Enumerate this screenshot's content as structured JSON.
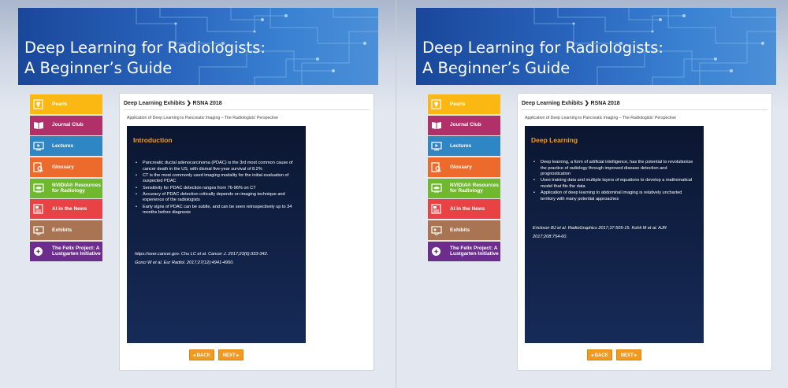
{
  "banner": {
    "title_line1": "Deep Learning for Radiologists:",
    "title_line2": "A Beginner’s Guide"
  },
  "sidebar": {
    "items": [
      {
        "label": "Pearls",
        "color": "#fbb813",
        "icon": "lightbulb-icon"
      },
      {
        "label": "Journal Club",
        "color": "#b2306a",
        "icon": "book-icon"
      },
      {
        "label": "Lectures",
        "color": "#2f86c4",
        "icon": "video-icon"
      },
      {
        "label": "Glossary",
        "color": "#ec6a2c",
        "icon": "glossary-icon"
      },
      {
        "label": "NVIDIA® Resources for Radiology",
        "color": "#70b92f",
        "icon": "nvidia-icon"
      },
      {
        "label": "AI in the News",
        "color": "#e84245",
        "icon": "news-icon"
      },
      {
        "label": "Exhibits",
        "color": "#a97451",
        "icon": "exhibit-icon"
      },
      {
        "label": "The Felix Project: A Lustgarten Initiative",
        "color": "#6c2d8c",
        "icon": "project-icon"
      }
    ]
  },
  "content": {
    "breadcrumb": "Deep Learning Exhibits ❯ RSNA 2018",
    "subtitle": "Application of Deep Learning to Pancreatic Imaging – The Radiologists’ Perspective",
    "back_label": "◂ BACK",
    "next_label": "NEXT ▸"
  },
  "slides": [
    {
      "title": "Introduction",
      "bullets": [
        "Pancreatic ductal adenocarcinoma (PDAC) is the 3rd most common cause of cancer death in the US, with dismal five-year survival of 8.2%",
        "CT is the most commonly used imaging modality for the initial evaluation of suspected PDAC",
        "Sensitivity for PDAC detection ranges from 76-96% on CT",
        "Accuracy of PDAC detection critically depends on imaging technique and experience of the radiologists",
        "Early signs of PDAC can be subtle, and can be seen retrospectively up to 34 months before diagnosis"
      ],
      "references": [
        "https://seer.cancer.gov. Chu LC et al. Cancer J. 2017;23(6):333-342.",
        "Gonci W et al. Eur Radiol. 2017;27(12):4941-4950."
      ]
    },
    {
      "title": "Deep Learning",
      "bullets": [
        "Deep learning, a form of artificial intelligence, has the potential to revolutionize the practice of radiology through improved disease detection and prognostication",
        "Uses training data and multiple layers of equations to develop a mathematical model that fits the data",
        "Application of deep learning to abdominal imaging is relatively uncharted territory with many potential approaches"
      ],
      "references": [
        "Erickson BJ et al. RadioGraphics 2017;37:505-15. Kohli M et al. AJR 2017;208:754-60."
      ]
    }
  ]
}
